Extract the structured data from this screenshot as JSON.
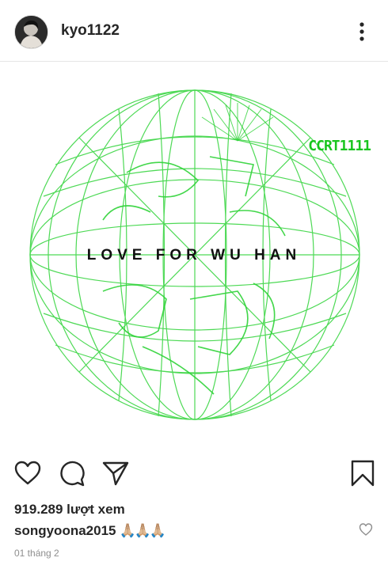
{
  "header": {
    "username": "kyo1122",
    "avatar_icon": "profile-photo",
    "more_icon": "more-vertical-icon"
  },
  "post": {
    "brand": "CCRT1111",
    "text": "LOVE FOR WU HAN",
    "accent_color": "#19c51e"
  },
  "actions": {
    "like_icon": "heart-icon",
    "comment_icon": "comment-icon",
    "share_icon": "send-icon",
    "save_icon": "bookmark-icon"
  },
  "stats": {
    "views": "919.289 lượt xem"
  },
  "comment": {
    "username": "songyoona2015",
    "text": "🙏🏼🙏🏼🙏🏼"
  },
  "date": "01 tháng 2"
}
